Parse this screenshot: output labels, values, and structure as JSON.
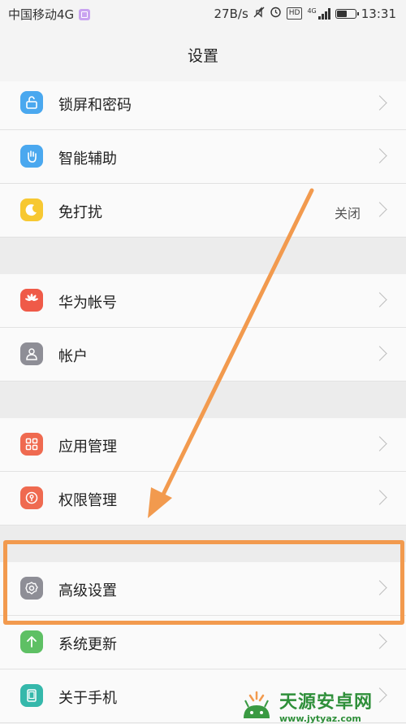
{
  "status": {
    "carrier": "中国移动4G",
    "speed": "27B/s",
    "network": "4G",
    "hd": "HD",
    "time": "13:31",
    "battery_level": 0.6
  },
  "header": {
    "title": "设置"
  },
  "rows": [
    {
      "name": "lock-screen",
      "label": "锁屏和密码",
      "icon": "lock-icon",
      "color": "#4aa8ef"
    },
    {
      "name": "smart-assist",
      "label": "智能辅助",
      "icon": "hand-icon",
      "color": "#4aa8ef"
    },
    {
      "name": "do-not-disturb",
      "label": "免打扰",
      "value": "关闭",
      "icon": "moon-icon",
      "color": "#f7c832"
    },
    {
      "name": "huawei-account",
      "label": "华为帐号",
      "icon": "huawei-icon",
      "color": "#ef5a48"
    },
    {
      "name": "accounts",
      "label": "帐户",
      "icon": "person-icon",
      "color": "#8e8e96"
    },
    {
      "name": "app-manager",
      "label": "应用管理",
      "icon": "grid-icon",
      "color": "#ef6a50"
    },
    {
      "name": "permission-manager",
      "label": "权限管理",
      "icon": "key-icon",
      "color": "#ef6a50"
    },
    {
      "name": "advanced-settings",
      "label": "高级设置",
      "icon": "gear-icon",
      "color": "#8e8e96"
    },
    {
      "name": "system-update",
      "label": "系统更新",
      "icon": "arrow-up-icon",
      "color": "#5ec064"
    },
    {
      "name": "about-phone",
      "label": "关于手机",
      "icon": "phone-icon",
      "color": "#35b8ab"
    }
  ],
  "watermark": {
    "big": "天源安卓网",
    "small": "www.jytyaz.com"
  },
  "colors": {
    "highlight": "#f29a4e",
    "arrow": "#f29a4e"
  }
}
